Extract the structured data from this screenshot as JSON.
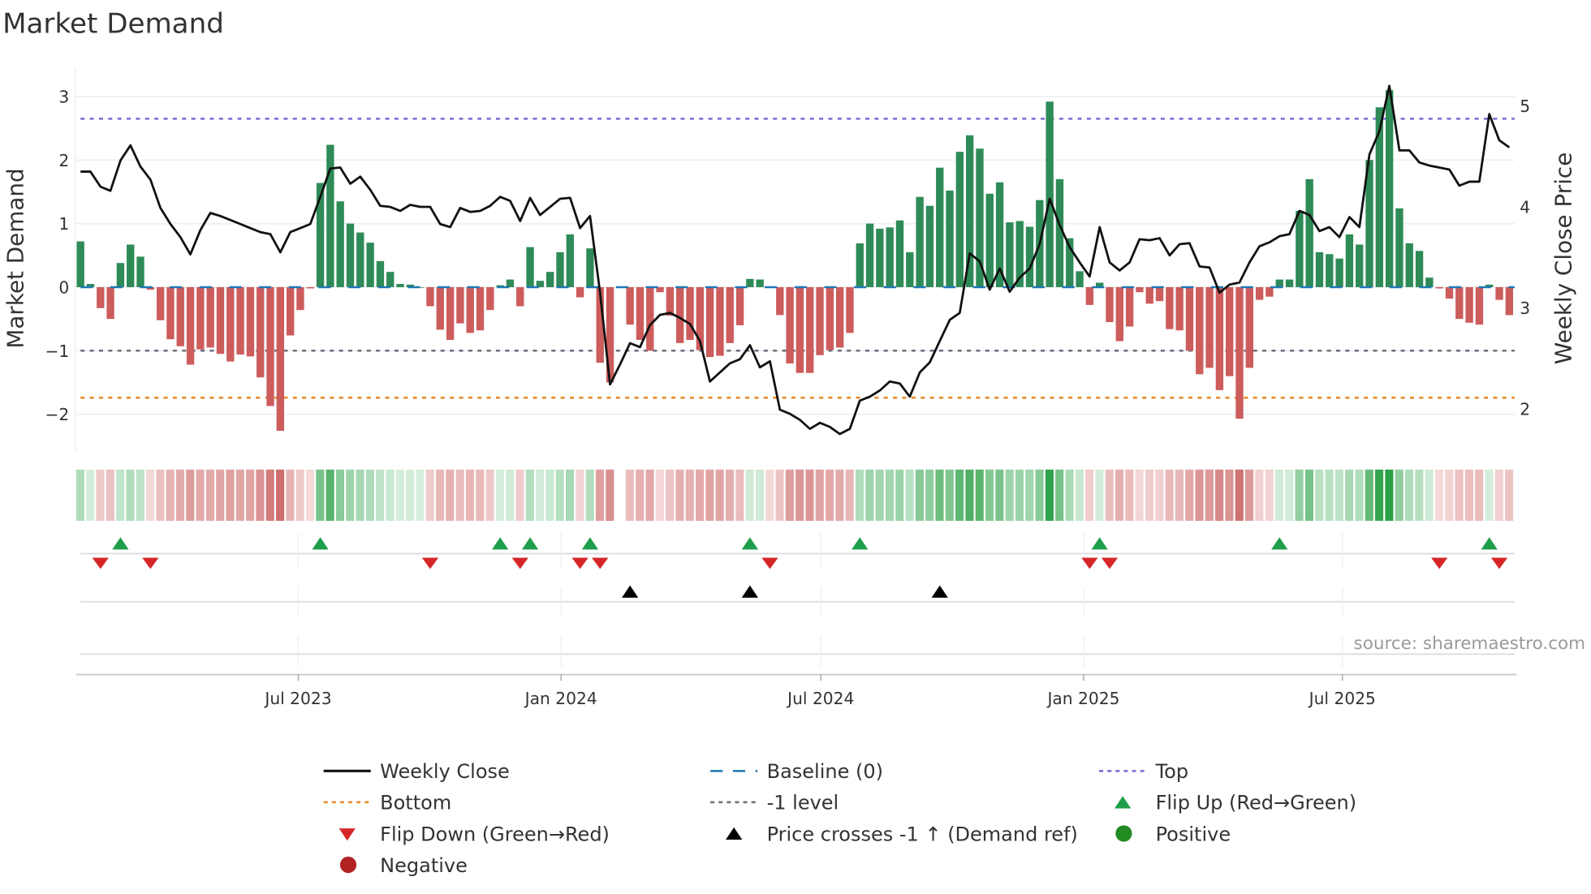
{
  "chart_data": {
    "type": "bar",
    "title": "Market Demand",
    "ylabel": "Market Demand",
    "y2label": "Weekly Close Price",
    "ylim": [
      -2.58,
      3.47
    ],
    "y2lim": [
      1.58,
      5.39
    ],
    "yticks": [
      {
        "v": 3,
        "label": "3"
      },
      {
        "v": 2,
        "label": "2"
      },
      {
        "v": 1,
        "label": "1"
      },
      {
        "v": 0,
        "label": "0"
      },
      {
        "v": -1,
        "label": "−1"
      },
      {
        "v": -2,
        "label": "−2"
      }
    ],
    "y2ticks": [
      {
        "v": 5,
        "label": "5"
      },
      {
        "v": 4,
        "label": "4"
      },
      {
        "v": 3,
        "label": "3"
      },
      {
        "v": 2,
        "label": "2"
      }
    ],
    "x_unit": "week index",
    "xticks": [
      {
        "week": 21.8,
        "label": "Jul 2023"
      },
      {
        "week": 48.1,
        "label": "Jan 2024"
      },
      {
        "week": 74.1,
        "label": "Jul 2024"
      },
      {
        "week": 100.4,
        "label": "Jan 2025"
      },
      {
        "week": 126.3,
        "label": "Jul 2025"
      }
    ],
    "levels": {
      "top": 2.65,
      "bottom": -1.74,
      "minus_one": -1,
      "baseline": 0
    },
    "demand": [
      0.72,
      0.05,
      -0.33,
      -0.5,
      0.38,
      0.67,
      0.48,
      -0.04,
      -0.52,
      -0.82,
      -0.93,
      -1.22,
      -0.98,
      -0.95,
      -1.05,
      -1.17,
      -1.06,
      -1.09,
      -1.42,
      -1.87,
      -2.26,
      -0.76,
      -0.36,
      -0.02,
      1.64,
      2.24,
      1.35,
      1.0,
      0.86,
      0.7,
      0.41,
      0.24,
      0.05,
      0.04,
      0.0,
      -0.3,
      -0.67,
      -0.83,
      -0.57,
      -0.72,
      -0.68,
      -0.36,
      0.03,
      0.12,
      -0.3,
      0.63,
      0.1,
      0.24,
      0.55,
      0.83,
      -0.16,
      0.61,
      -1.19,
      -1.5,
      null,
      -0.59,
      -0.83,
      -1.0,
      -0.08,
      -0.45,
      -0.88,
      -0.83,
      -0.99,
      -1.1,
      -1.08,
      -0.88,
      -0.6,
      0.13,
      0.12,
      -0.01,
      -0.44,
      -1.2,
      -1.35,
      -1.35,
      -1.07,
      -0.99,
      -0.95,
      -0.72,
      0.69,
      1.0,
      0.92,
      0.94,
      1.05,
      0.55,
      1.42,
      1.28,
      1.88,
      1.52,
      2.13,
      2.39,
      2.18,
      1.47,
      1.65,
      1.02,
      1.04,
      0.95,
      1.37,
      2.92,
      1.7,
      0.77,
      0.25,
      -0.28,
      0.07,
      -0.55,
      -0.85,
      -0.62,
      -0.08,
      -0.26,
      -0.22,
      -0.66,
      -0.68,
      -1.0,
      -1.37,
      -1.27,
      -1.62,
      -1.4,
      -2.07,
      -1.27,
      -0.2,
      -0.15,
      0.12,
      0.12,
      1.2,
      1.7,
      0.55,
      0.52,
      0.45,
      0.83,
      0.67,
      2.0,
      2.83,
      3.1,
      1.24,
      0.69,
      0.57,
      0.15,
      -0.02,
      -0.18,
      -0.5,
      -0.56,
      -0.59,
      0.04,
      -0.2,
      -0.44
    ],
    "weekly_close": [
      4.35,
      4.35,
      4.2,
      4.16,
      4.46,
      4.61,
      4.4,
      4.27,
      3.99,
      3.83,
      3.7,
      3.53,
      3.77,
      3.94,
      3.91,
      3.87,
      3.83,
      3.79,
      3.75,
      3.73,
      3.55,
      3.75,
      3.79,
      3.83,
      4.1,
      4.38,
      4.39,
      4.23,
      4.3,
      4.17,
      4.01,
      4.0,
      3.96,
      4.02,
      4.0,
      4.0,
      3.83,
      3.8,
      3.99,
      3.95,
      3.96,
      4.01,
      4.1,
      4.06,
      3.86,
      4.09,
      3.92,
      4.0,
      4.08,
      4.09,
      3.79,
      3.91,
      3.15,
      2.24,
      2.44,
      2.65,
      2.61,
      2.83,
      2.93,
      2.95,
      2.9,
      2.84,
      2.67,
      2.27,
      2.36,
      2.45,
      2.49,
      2.63,
      2.41,
      2.47,
      1.99,
      1.95,
      1.89,
      1.8,
      1.86,
      1.82,
      1.75,
      1.8,
      2.08,
      2.12,
      2.18,
      2.27,
      2.25,
      2.12,
      2.36,
      2.46,
      2.67,
      2.88,
      2.95,
      3.54,
      3.46,
      3.18,
      3.39,
      3.16,
      3.3,
      3.39,
      3.63,
      4.08,
      3.82,
      3.6,
      3.45,
      3.31,
      3.8,
      3.45,
      3.37,
      3.45,
      3.68,
      3.67,
      3.69,
      3.52,
      3.63,
      3.64,
      3.41,
      3.4,
      3.15,
      3.23,
      3.25,
      3.45,
      3.61,
      3.65,
      3.71,
      3.73,
      3.96,
      3.92,
      3.76,
      3.8,
      3.7,
      3.9,
      3.8,
      4.52,
      4.75,
      5.2,
      4.56,
      4.56,
      4.44,
      4.41,
      4.39,
      4.37,
      4.21,
      4.25,
      4.25,
      4.92,
      4.66,
      4.59
    ],
    "flip_up_weeks": [
      4,
      24,
      42,
      45,
      51,
      67,
      78,
      102,
      120,
      141
    ],
    "flip_down_weeks": [
      2,
      7,
      35,
      44,
      50,
      52,
      69,
      101,
      103,
      136,
      142
    ],
    "price_cross_weeks": [
      55,
      67,
      86
    ],
    "colors": {
      "positive": "#2e8b57",
      "negative": "#cd5c5c",
      "price": "#111111",
      "baseline": "#1f77b4",
      "top": "#7b68d8",
      "bottom": "#e8891c",
      "minus_one": "#6e6e7e",
      "flip_up": "#1e9e4a",
      "flip_down": "#d62728",
      "cross": "#000000",
      "pos_dot": "#228b22",
      "neg_dot": "#b22222"
    },
    "legend": [
      {
        "label": "Weekly Close",
        "kind": "line"
      },
      {
        "label": "Baseline (0)",
        "kind": "dash"
      },
      {
        "label": "Top",
        "kind": "dot-top"
      },
      {
        "label": "Bottom",
        "kind": "dot-bottom"
      },
      {
        "label": "-1 level",
        "kind": "dot-m1"
      },
      {
        "label": "Flip Up (Red→Green)",
        "kind": "tri-up"
      },
      {
        "label": "Flip Down (Green→Red)",
        "kind": "tri-down"
      },
      {
        "label": "Price crosses -1 ↑ (Demand ref)",
        "kind": "tri-black"
      },
      {
        "label": "Positive",
        "kind": "dot-pos"
      },
      {
        "label": "Negative",
        "kind": "dot-neg"
      }
    ],
    "source": "source: sharemaestro.com"
  }
}
